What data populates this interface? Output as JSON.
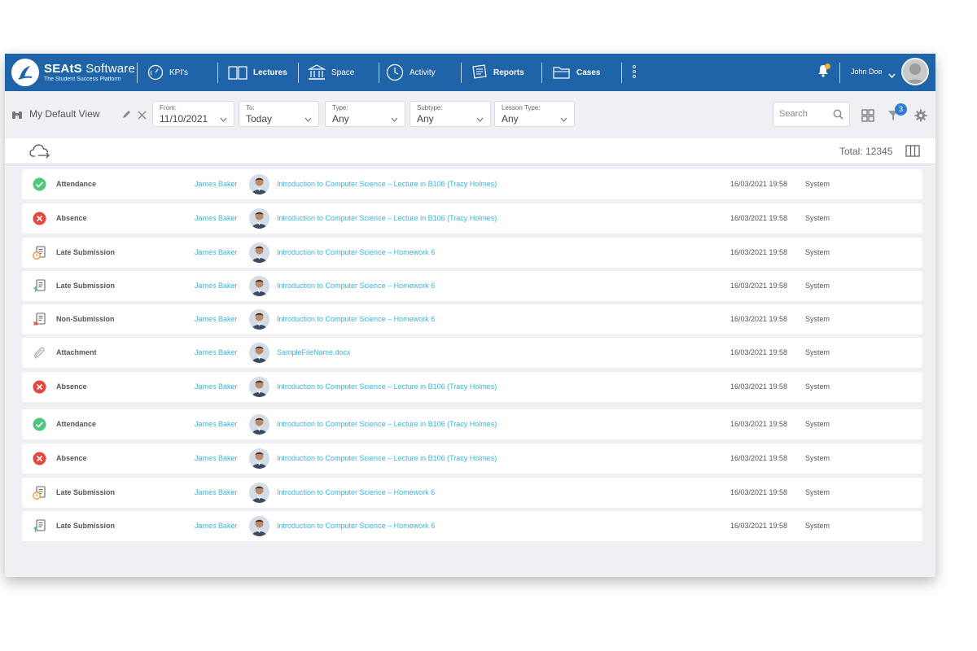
{
  "brand": {
    "name_bold": "SEAtS",
    "name_light": " Software",
    "tagline": "The Student Success Platform"
  },
  "nav": [
    {
      "label": "KPI's",
      "icon": "gauge-icon"
    },
    {
      "label": "Lectures",
      "icon": "book-icon"
    },
    {
      "label": "Space",
      "icon": "building-icon"
    },
    {
      "label": "Activity",
      "icon": "clock-icon"
    },
    {
      "label": "Reports",
      "icon": "report-icon"
    },
    {
      "label": "Cases",
      "icon": "folder-icon"
    }
  ],
  "user": {
    "name": "John Doe"
  },
  "filters": {
    "view_name": "My Default View",
    "from": {
      "label": "From:",
      "value": "11/10/2021"
    },
    "to": {
      "label": "To:",
      "value": "Today"
    },
    "type": {
      "label": "Type:",
      "value": "Any"
    },
    "subtype": {
      "label": "Subtype:",
      "value": "Any"
    },
    "lesson_type": {
      "label": "Lesson Type:",
      "value": "Any"
    },
    "search_placeholder": "Search",
    "filter_count": "3"
  },
  "total_label": "Total: 12345",
  "rows": [
    {
      "status": "attendance",
      "type": "Attendance",
      "student": "James Baker",
      "description": "Introduction to Computer Science – Lecture in B106 (Tracy Holmes)",
      "datetime": "16/03/2021 19:58",
      "source": "System"
    },
    {
      "status": "absence",
      "type": "Absence",
      "student": "James Baker",
      "description": "Introduction to Computer Science – Lecture in B106 (Tracy Holmes)",
      "datetime": "16/03/2021 19:58",
      "source": "System"
    },
    {
      "status": "late-clock",
      "type": "Late Submission",
      "student": "James Baker",
      "description": "Introduction to Computer Science – Homework 6",
      "datetime": "16/03/2021 19:58",
      "source": "System"
    },
    {
      "status": "late-upload",
      "type": "Late Submission",
      "student": "James Baker",
      "description": "Introduction to Computer Science – Homework 6",
      "datetime": "16/03/2021 19:58",
      "source": "System"
    },
    {
      "status": "non-submission",
      "type": "Non-Submission",
      "student": "James Baker",
      "description": "Introduction to Computer Science – Homework 6",
      "datetime": "16/03/2021 19:58",
      "source": "System"
    },
    {
      "status": "attachment",
      "type": "Attachment",
      "student": "James Baker",
      "description": "SampleFileName.docx",
      "datetime": "16/03/2021 19:58",
      "source": "System"
    },
    {
      "status": "absence",
      "type": "Absence",
      "student": "James Baker",
      "description": "Introduction to Computer Science – Lecture in B106 (Tracy Holmes)",
      "datetime": "16/03/2021 19:58",
      "source": "System"
    },
    {
      "status": "attendance",
      "type": "Attendance",
      "student": "James Baker",
      "description": "Introduction to Computer Science – Lecture in B106 (Tracy Holmes)",
      "datetime": "16/03/2021 19:58",
      "source": "System"
    },
    {
      "status": "absence",
      "type": "Absence",
      "student": "James Baker",
      "description": "Introduction to Computer Science – Lecture in B106 (Tracy Holmes)",
      "datetime": "16/03/2021 19:58",
      "source": "System"
    },
    {
      "status": "late-clock",
      "type": "Late Submission",
      "student": "James Baker",
      "description": "Introduction to Computer Science – Homework 6",
      "datetime": "16/03/2021 19:58",
      "source": "System"
    },
    {
      "status": "late-upload",
      "type": "Late Submission",
      "student": "James Baker",
      "description": "Introduction to Computer Science – Homework 6",
      "datetime": "16/03/2021 19:58",
      "source": "System"
    }
  ],
  "colors": {
    "nav_bg": "#1f63a8",
    "link": "#3cb3e0",
    "success": "#4cc77b",
    "danger": "#e4483d",
    "badge": "#2f7bd6"
  }
}
